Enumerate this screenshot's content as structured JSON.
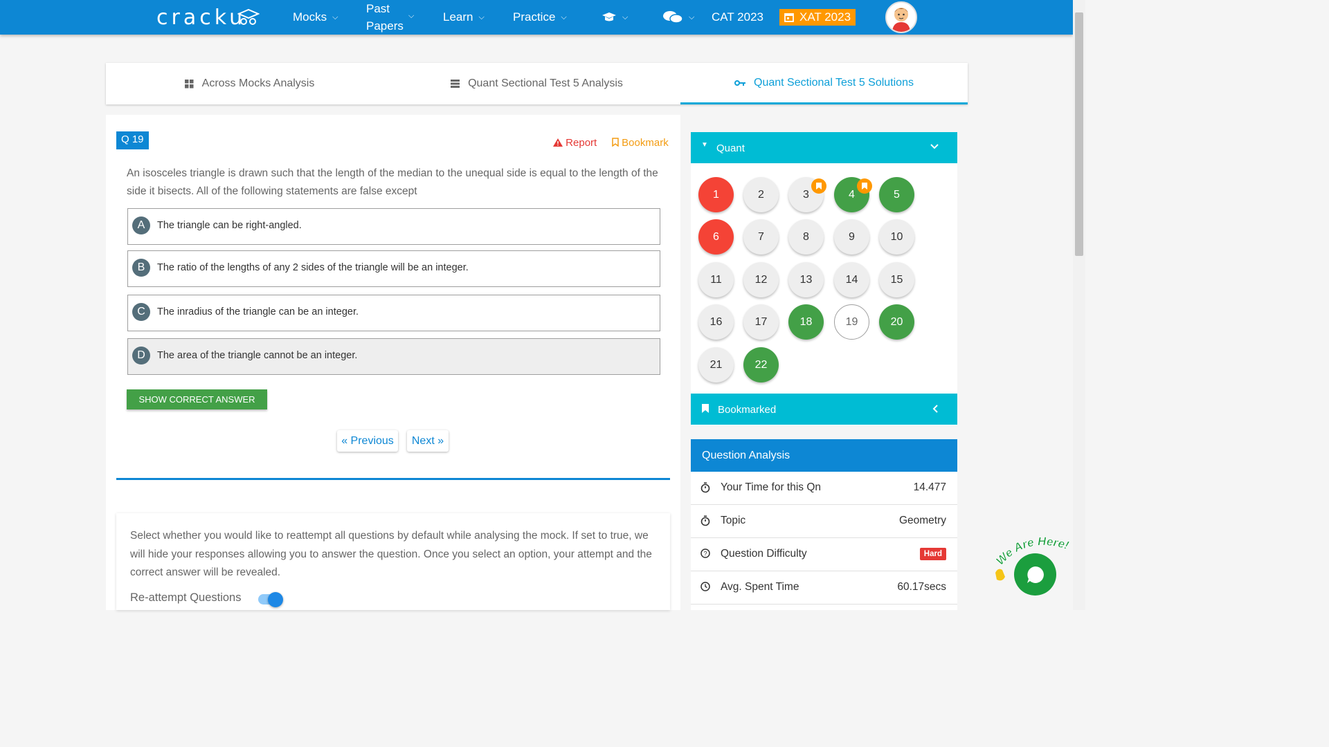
{
  "nav": {
    "logo": "cracku",
    "mocks": "Mocks",
    "past_papers_line1": "Past",
    "past_papers_line2": "Papers",
    "learn": "Learn",
    "practice": "Practice",
    "cat": "CAT 2023",
    "xat": "XAT 2023"
  },
  "tabs": [
    {
      "label": "Across Mocks Analysis",
      "icon": "grid-icon",
      "active": false
    },
    {
      "label": "Quant Sectional Test 5 Analysis",
      "icon": "list-icon",
      "active": false
    },
    {
      "label": "Quant Sectional Test 5 Solutions",
      "icon": "key-icon",
      "active": true
    }
  ],
  "question": {
    "badge": "Q 19",
    "report": "Report",
    "bookmark": "Bookmark",
    "text": "An isosceles triangle is drawn such that the length of the median to the unequal side is equal to the length of the side it bisects. All of the following statements are false except",
    "options": [
      {
        "letter": "A",
        "text": "The triangle can be right-angled."
      },
      {
        "letter": "B",
        "text": "The ratio of the lengths of any 2 sides of the triangle will be an integer."
      },
      {
        "letter": "C",
        "text": "The inradius of the triangle can be an integer."
      },
      {
        "letter": "D",
        "text": "The area of the triangle cannot be an integer.",
        "selected": true
      }
    ],
    "show_answer": "SHOW CORRECT ANSWER",
    "previous": "« Previous",
    "next": "Next »"
  },
  "reattempt": {
    "text": "Select whether you would like to reattempt all questions by default while analysing the mock. If set to true, we will hide your responses allowing you to answer the question. Once you select an option, your attempt and the correct answer will be revealed.",
    "label": "Re-attempt Questions",
    "enabled": true
  },
  "palette": {
    "section": "Quant",
    "bookmarked_label": "Bookmarked",
    "questions": [
      {
        "n": "1",
        "status": "wrong"
      },
      {
        "n": "2",
        "status": "unattempted"
      },
      {
        "n": "3",
        "status": "unattempted",
        "bookmarked": true
      },
      {
        "n": "4",
        "status": "correct",
        "bookmarked": true
      },
      {
        "n": "5",
        "status": "correct"
      },
      {
        "n": "6",
        "status": "wrong"
      },
      {
        "n": "7",
        "status": "unattempted"
      },
      {
        "n": "8",
        "status": "unattempted"
      },
      {
        "n": "9",
        "status": "unattempted"
      },
      {
        "n": "10",
        "status": "unattempted"
      },
      {
        "n": "11",
        "status": "unattempted"
      },
      {
        "n": "12",
        "status": "unattempted"
      },
      {
        "n": "13",
        "status": "unattempted"
      },
      {
        "n": "14",
        "status": "unattempted"
      },
      {
        "n": "15",
        "status": "unattempted"
      },
      {
        "n": "16",
        "status": "unattempted"
      },
      {
        "n": "17",
        "status": "unattempted"
      },
      {
        "n": "18",
        "status": "correct"
      },
      {
        "n": "19",
        "status": "current"
      },
      {
        "n": "20",
        "status": "correct"
      },
      {
        "n": "21",
        "status": "unattempted"
      },
      {
        "n": "22",
        "status": "correct"
      }
    ]
  },
  "analysis": {
    "title": "Question Analysis",
    "your_time_label": "Your Time for this Qn",
    "your_time_value": "14.477",
    "topic_label": "Topic",
    "topic_value": "Geometry",
    "difficulty_label": "Question Difficulty",
    "difficulty_value": "Hard",
    "avg_label": "Avg. Spent Time",
    "avg_value": "60.17secs"
  },
  "chat": {
    "tagline": "We Are Here!"
  },
  "colors": {
    "primary": "#0d87d4",
    "accent": "#00bcd4",
    "correct": "#43a047",
    "wrong": "#f44336",
    "bookmark": "#ff9800"
  }
}
